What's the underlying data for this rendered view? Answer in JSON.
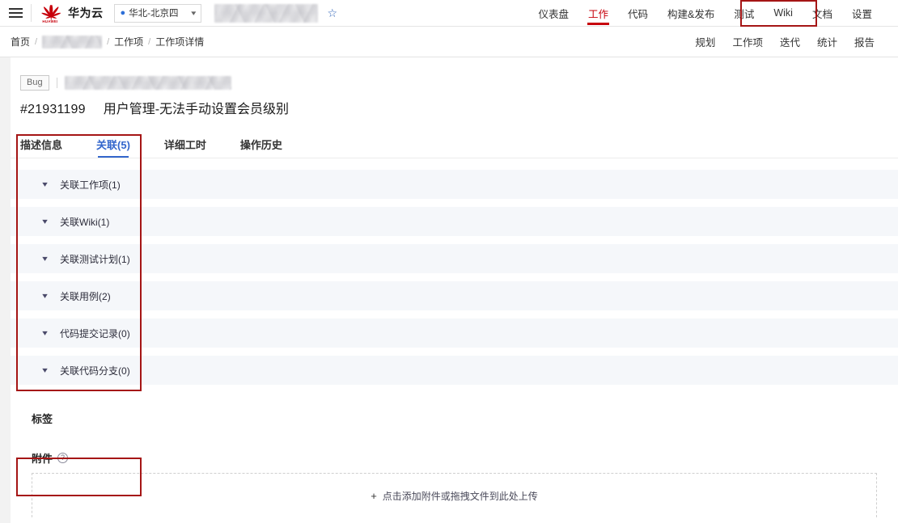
{
  "header": {
    "menu_icon": "hamburger-icon",
    "brand": "华为云",
    "brand_logo": "huawei-logo",
    "region": {
      "label": "华北-北京四",
      "pin_icon": "location-pin-icon",
      "chevron_icon": "chevron-down-icon"
    },
    "project_name_redacted": "",
    "favorite_icon": "star-icon",
    "nav": [
      {
        "label": "仪表盘",
        "active": false
      },
      {
        "label": "工作",
        "active": true
      },
      {
        "label": "代码",
        "active": false
      },
      {
        "label": "构建&发布",
        "active": false
      },
      {
        "label": "测试",
        "active": false
      },
      {
        "label": "Wiki",
        "active": false
      },
      {
        "label": "文档",
        "active": false
      },
      {
        "label": "设置",
        "active": false
      }
    ],
    "active_nav_color": "#c7000b"
  },
  "subheader": {
    "breadcrumb": [
      {
        "label": "首页",
        "redacted": false
      },
      {
        "label": "",
        "redacted": true
      },
      {
        "label": "工作项",
        "redacted": false
      },
      {
        "label": "工作项详情",
        "redacted": false
      }
    ],
    "separator": "/",
    "sub_nav": [
      {
        "label": "规划"
      },
      {
        "label": "工作项"
      },
      {
        "label": "迭代"
      },
      {
        "label": "统计"
      },
      {
        "label": "报告"
      }
    ]
  },
  "work_item": {
    "type_badge": "Bug",
    "path_redacted": "",
    "id": "#21931199",
    "title": "用户管理-无法手动设置会员级别"
  },
  "tabs": [
    {
      "label": "描述信息",
      "active": false
    },
    {
      "label": "关联(5)",
      "active": true
    },
    {
      "label": "详细工时",
      "active": false
    },
    {
      "label": "操作历史",
      "active": false
    }
  ],
  "active_tab_color": "#3366cc",
  "relations": [
    {
      "label": "关联工作项(1)",
      "chevron": "chevron-down-icon"
    },
    {
      "label": "关联Wiki(1)",
      "chevron": "chevron-down-icon"
    },
    {
      "label": "关联测试计划(1)",
      "chevron": "chevron-down-icon"
    },
    {
      "label": "关联用例(2)",
      "chevron": "chevron-down-icon"
    },
    {
      "label": "代码提交记录(0)",
      "chevron": "chevron-down-icon"
    },
    {
      "label": "关联代码分支(0)",
      "chevron": "chevron-down-icon"
    }
  ],
  "tags_section": {
    "title": "标签"
  },
  "attachment_section": {
    "title": "附件",
    "help_icon": "question-mark-icon",
    "help_glyph": "?",
    "dropzone_text": "点击添加附件或拖拽文件到此处上传",
    "plus_glyph": "+"
  },
  "annotations": {
    "color": "#a51515",
    "boxes": [
      {
        "name": "wiki-docs-nav-highlight"
      },
      {
        "name": "relations-tab-panel-highlight"
      },
      {
        "name": "attachment-header-highlight"
      }
    ]
  }
}
